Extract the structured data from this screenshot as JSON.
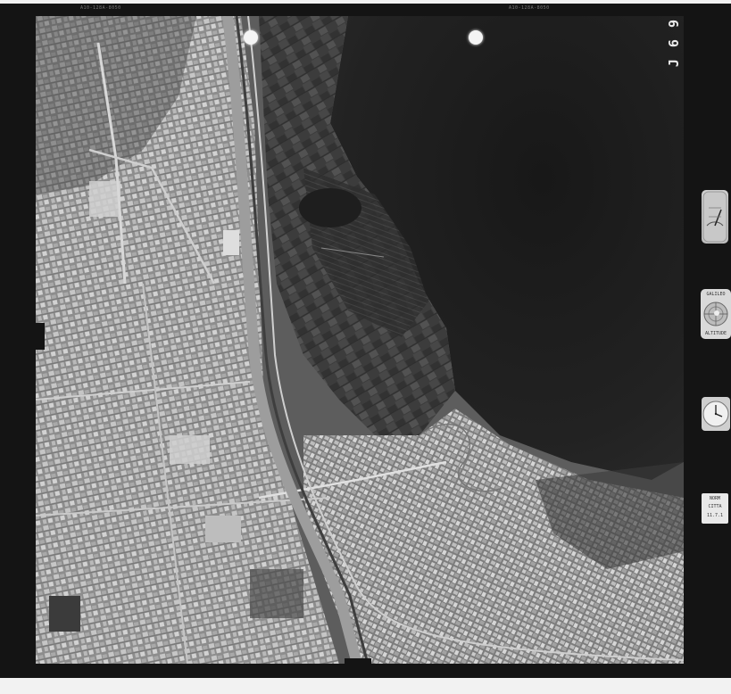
{
  "frame": {
    "frame_code": "J 6 9",
    "top_strip_left": "A10-128A-8050",
    "top_strip_right": "A10-128A-8050"
  },
  "instruments": {
    "level_label_top": "GALILEO",
    "level_label_bottom": "ALTITUDE",
    "counter_line1": "NORM",
    "counter_line2": "CITTA",
    "counter_line3": "11.7.1"
  },
  "colors": {
    "film_border": "#141414",
    "urban_light": "#a8a8a8",
    "urban_dark": "#595959",
    "hillside_dark": "#1d1d1d",
    "farmland": "#3d3d3d",
    "river": "#8f8f8f"
  },
  "icons": {
    "altimeter": "altimeter-dial-icon",
    "level": "bubble-level-icon",
    "clock": "clock-icon",
    "counter": "frame-counter-icon"
  }
}
